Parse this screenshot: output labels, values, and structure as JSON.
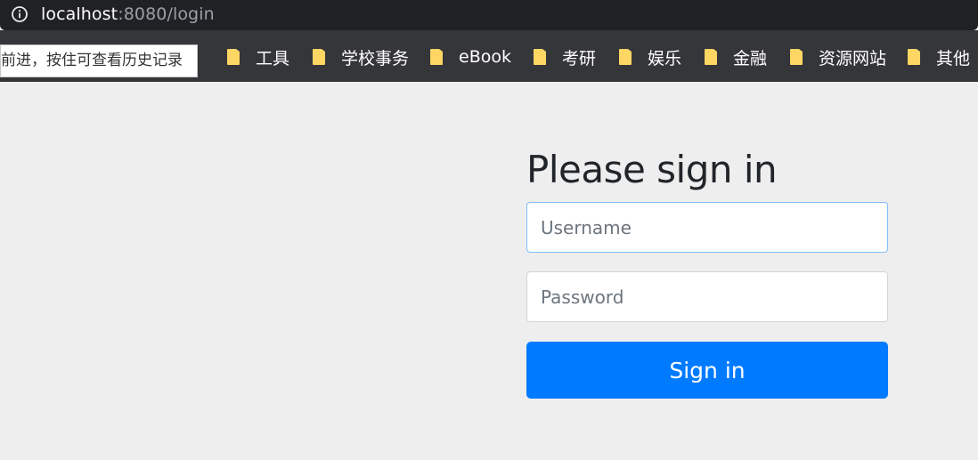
{
  "browser": {
    "url_host": "localhost",
    "url_path": ":8080/login",
    "info_icon": "info-icon"
  },
  "bookmarks": {
    "tooltip": "前进，按住可查看历史记录",
    "items": [
      {
        "label": "工具",
        "icon": "folder-icon"
      },
      {
        "label": "学校事务",
        "icon": "folder-icon"
      },
      {
        "label": "eBook",
        "icon": "folder-icon"
      },
      {
        "label": "考研",
        "icon": "folder-icon"
      },
      {
        "label": "娱乐",
        "icon": "folder-icon"
      },
      {
        "label": "金融",
        "icon": "folder-icon"
      },
      {
        "label": "资源网站",
        "icon": "folder-icon"
      },
      {
        "label": "其他",
        "icon": "folder-icon"
      }
    ]
  },
  "login": {
    "heading": "Please sign in",
    "username_placeholder": "Username",
    "username_value": "",
    "password_placeholder": "Password",
    "password_value": "",
    "submit_label": "Sign in"
  },
  "colors": {
    "primary": "#007bff",
    "focus_border": "#80bdff",
    "page_background": "#eeeeee",
    "folder": "#fdd663"
  }
}
